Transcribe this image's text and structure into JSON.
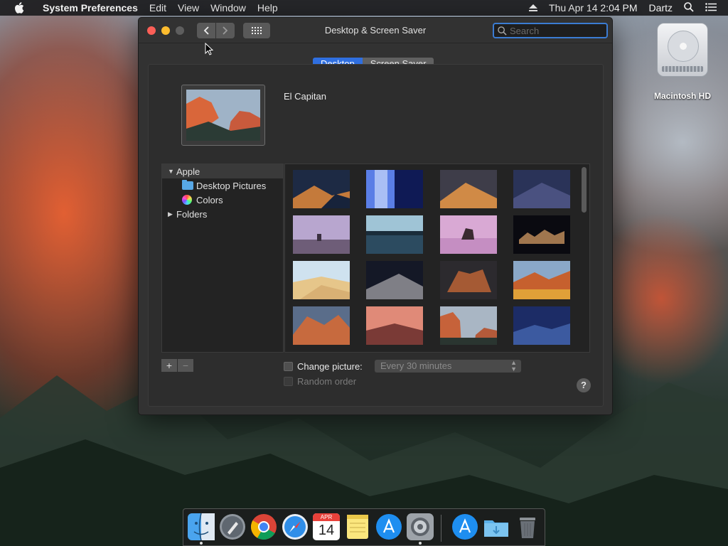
{
  "menubar": {
    "app_name": "System Preferences",
    "items": [
      "Edit",
      "View",
      "Window",
      "Help"
    ],
    "clock": "Thu Apr 14  2:04 PM",
    "user": "Dartz"
  },
  "desktop": {
    "drive_label": "Macintosh HD"
  },
  "window": {
    "title": "Desktop & Screen Saver",
    "search_placeholder": "Search",
    "tabs": [
      "Desktop",
      "Screen Saver"
    ],
    "current_picture_name": "El Capitan",
    "source_list": {
      "group_apple": "Apple",
      "desktop_pictures": "Desktop Pictures",
      "colors": "Colors",
      "folders": "Folders"
    },
    "change_picture_label": "Change picture:",
    "interval_value": "Every 30 minutes",
    "random_order_label": "Random order",
    "add_label": "+",
    "remove_label": "−",
    "help_label": "?"
  },
  "dock": {
    "calendar_month": "APR",
    "calendar_day": "14"
  }
}
